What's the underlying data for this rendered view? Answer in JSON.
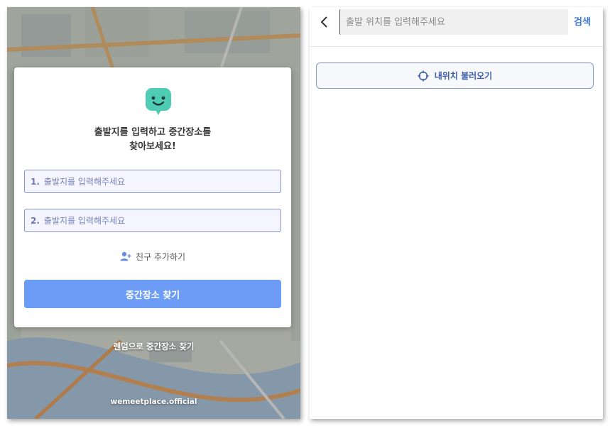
{
  "left": {
    "headline_line1": "출발지를 입력하고 중간장소를",
    "headline_line2": "찾아보세요!",
    "field1": {
      "number": "1.",
      "placeholder": "출발지를 입력해주세요"
    },
    "field2": {
      "number": "2.",
      "placeholder": "출발지를 입력해주세요"
    },
    "add_friend_label": "친구 추가하기",
    "find_button_label": "중간장소 찾기",
    "random_link": "렌덤으로 중간장소 찾기",
    "footer": "wemeetplace.official"
  },
  "right": {
    "search_placeholder": "출발 위치를 입력해주세요",
    "search_button_label": "검색",
    "locate_button_label": "내위치 불러오기"
  },
  "colors": {
    "accent": "#6c9cf5",
    "logo": "#4fcdb4",
    "field_border": "#8a93c8",
    "link_blue": "#3d7bd9"
  },
  "icons": [
    "chat-face-logo-icon",
    "person-add-icon",
    "back-chevron-icon",
    "crosshair-icon"
  ]
}
